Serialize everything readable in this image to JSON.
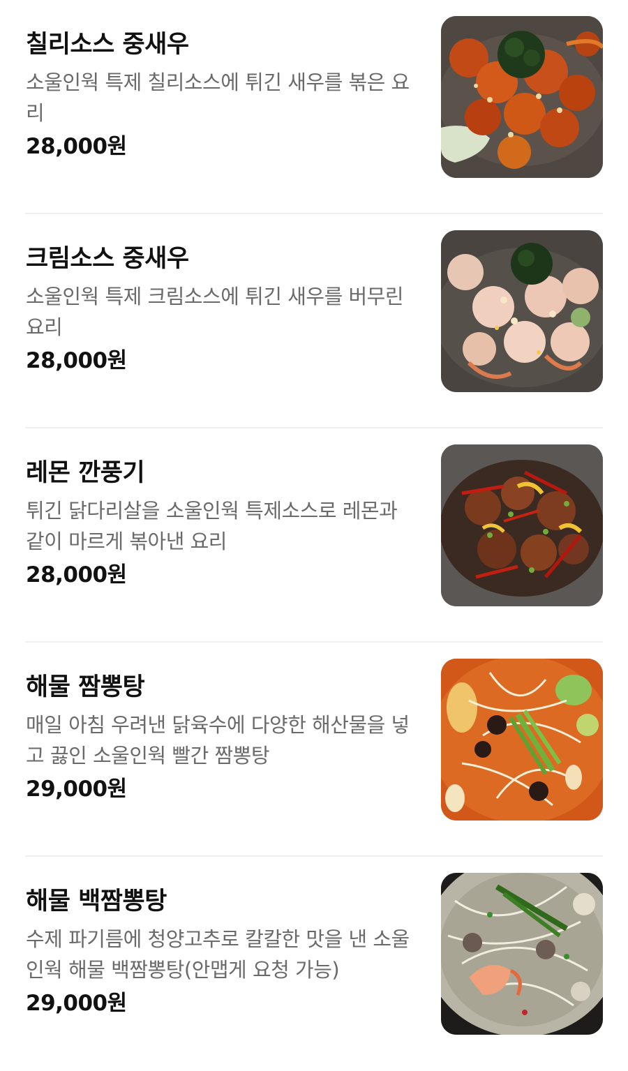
{
  "menu": {
    "items": [
      {
        "name": "칠리소스 중새우",
        "description": "소울인웍 특제 칠리소스에 튀긴 새우를 볶은 요리",
        "price": "28,000원",
        "photo": "chili-shrimp-photo"
      },
      {
        "name": "크림소스 중새우",
        "description": "소울인웍 특제 크림소스에 튀긴 새우를 버무린 요리",
        "price": "28,000원",
        "photo": "cream-shrimp-photo"
      },
      {
        "name": "레몬 깐풍기",
        "description": "튀긴 닭다리살을 소울인웍 특제소스로 레몬과 같이 마르게 볶아낸 요리",
        "price": "28,000원",
        "photo": "lemon-kkanpunggi-photo"
      },
      {
        "name": "해물 짬뽕탕",
        "description": "매일 아침 우려낸 닭육수에 다양한 해산물을 넣고 끓인 소울인웍 빨간 짬뽕탕",
        "price": "29,000원",
        "photo": "seafood-jjamppong-photo"
      },
      {
        "name": "해물 백짬뽕탕",
        "description": "수제 파기름에 청양고추로 칼칼한 맛을 낸 소울인웍 해물 백짬뽕탕(안맵게 요청 가능)",
        "price": "29,000원",
        "photo": "white-jjamppong-photo"
      }
    ]
  }
}
